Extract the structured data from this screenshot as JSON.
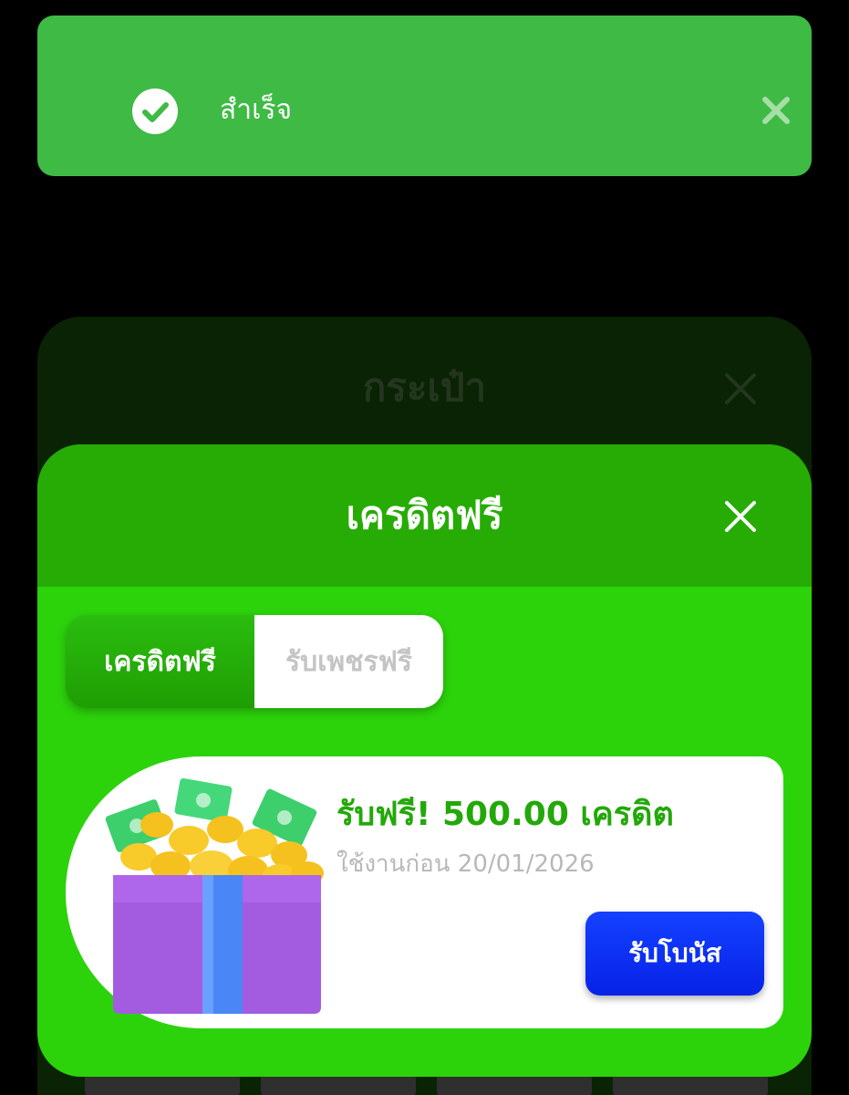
{
  "toast": {
    "message": "สำเร็จ",
    "icon": "check-circle-icon",
    "close_icon": "close-icon",
    "color": "#3fba45"
  },
  "wallet_modal": {
    "title": "กระเป๋า"
  },
  "credit_modal": {
    "title": "เครดิตฟรี",
    "tabs": [
      {
        "label": "เครดิตฟรี",
        "active": true
      },
      {
        "label": "รับเพชรฟรี",
        "active": false
      }
    ],
    "bonus": {
      "title": "รับฟรี! 500.00 เครดิต",
      "expiry": "ใช้งานก่อน 20/01/2026",
      "claim_label": "รับโบนัส",
      "image": "gift-box-coins-icon"
    },
    "colors": {
      "header": "#26ac04",
      "body": "#2cd30b",
      "accent_text": "#23a80a",
      "claim_button": "#0722e6"
    }
  }
}
